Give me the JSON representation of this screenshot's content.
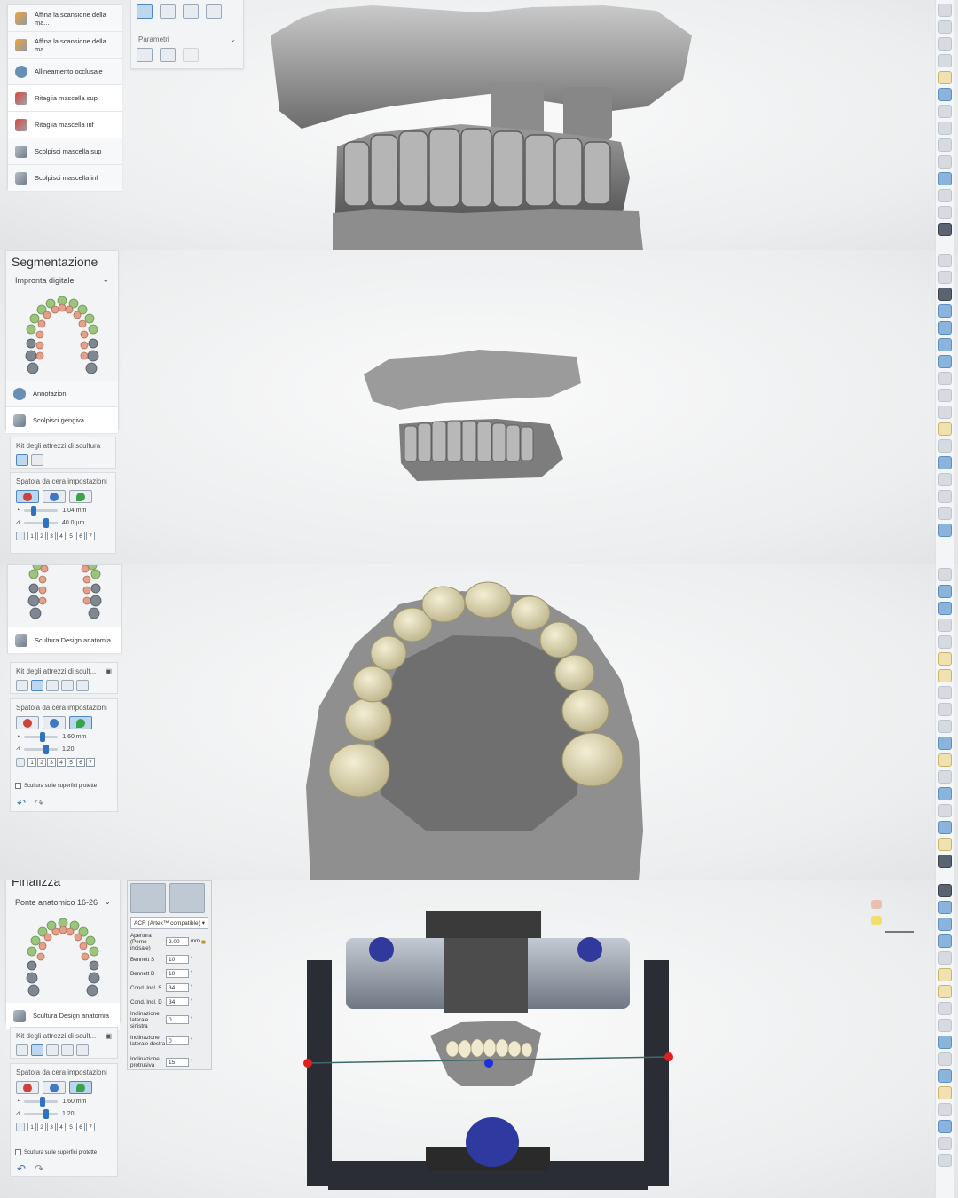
{
  "strip1": {
    "workflow_items": [
      {
        "label": "Affina la scansione della ma...",
        "icon": "refine-icon"
      },
      {
        "label": "Affina la scansione della ma...",
        "icon": "refine-icon"
      },
      {
        "label": "Allineamento occlusale",
        "icon": "occlusal-icon"
      },
      {
        "label": "Ritaglia mascella sup",
        "icon": "cut-icon"
      },
      {
        "label": "Ritaglia mascella inf",
        "icon": "cut-icon"
      },
      {
        "label": "Scolpisci mascella sup",
        "icon": "sculpt-icon"
      },
      {
        "label": "Scolpisci mascella inf",
        "icon": "sculpt-icon"
      }
    ],
    "param_label": "Parametri"
  },
  "strip2": {
    "title": "Segmentazione",
    "combo_value": "Impronta digitale",
    "items": [
      {
        "label": "Annotazioni"
      },
      {
        "label": "Scolpisci gengiva"
      }
    ],
    "kit_title": "Kit degli attrezzi di scultura",
    "spatula_title": "Spatola da cera impostazioni",
    "size_value": "1.04 mm",
    "strength_value": "40.0 µm",
    "numbers": [
      "1",
      "2",
      "3",
      "4",
      "5",
      "6",
      "7"
    ]
  },
  "strip3": {
    "item_label": "Scultura Design anatomia",
    "kit_title": "Kit degli attrezzi di scult...",
    "spatula_title": "Spatola da cera impostazioni",
    "size_value": "1.60 mm",
    "strength_value": "1.20",
    "numbers": [
      "1",
      "2",
      "3",
      "4",
      "5",
      "6",
      "7"
    ],
    "checkbox_label": "Scultura sulle superfici protette"
  },
  "strip4": {
    "title": "Finalizza",
    "combo_value": "Ponte anatomico 16-26",
    "item_label": "Scultura Design anatomia",
    "kit_title": "Kit degli attrezzi di scult...",
    "spatula_title": "Spatola da cera impostazioni",
    "size_value": "1.60 mm",
    "strength_value": "1.20",
    "numbers": [
      "1",
      "2",
      "3",
      "4",
      "5",
      "6",
      "7"
    ],
    "checkbox_label": "Scultura sulle superfici protette",
    "articulator": {
      "model": "ACR (Artex™ compatible)",
      "rows": [
        {
          "label": "Apertura (Perno incisale)",
          "value": "2.00",
          "unit": "mm"
        },
        {
          "label": "Bennett S",
          "value": "10",
          "unit": "°"
        },
        {
          "label": "Bennett D",
          "value": "10",
          "unit": "°"
        },
        {
          "label": "Cond. Incl. S",
          "value": "34",
          "unit": "°"
        },
        {
          "label": "Cond. Incl. D",
          "value": "34",
          "unit": "°"
        },
        {
          "label": "Inclinazione laterale sinistra",
          "value": "0",
          "unit": "°"
        },
        {
          "label": "Inclinazione laterale destra",
          "value": "0",
          "unit": "°"
        },
        {
          "label": "Inclinazione protrusiva",
          "value": "15",
          "unit": "°"
        }
      ]
    }
  }
}
